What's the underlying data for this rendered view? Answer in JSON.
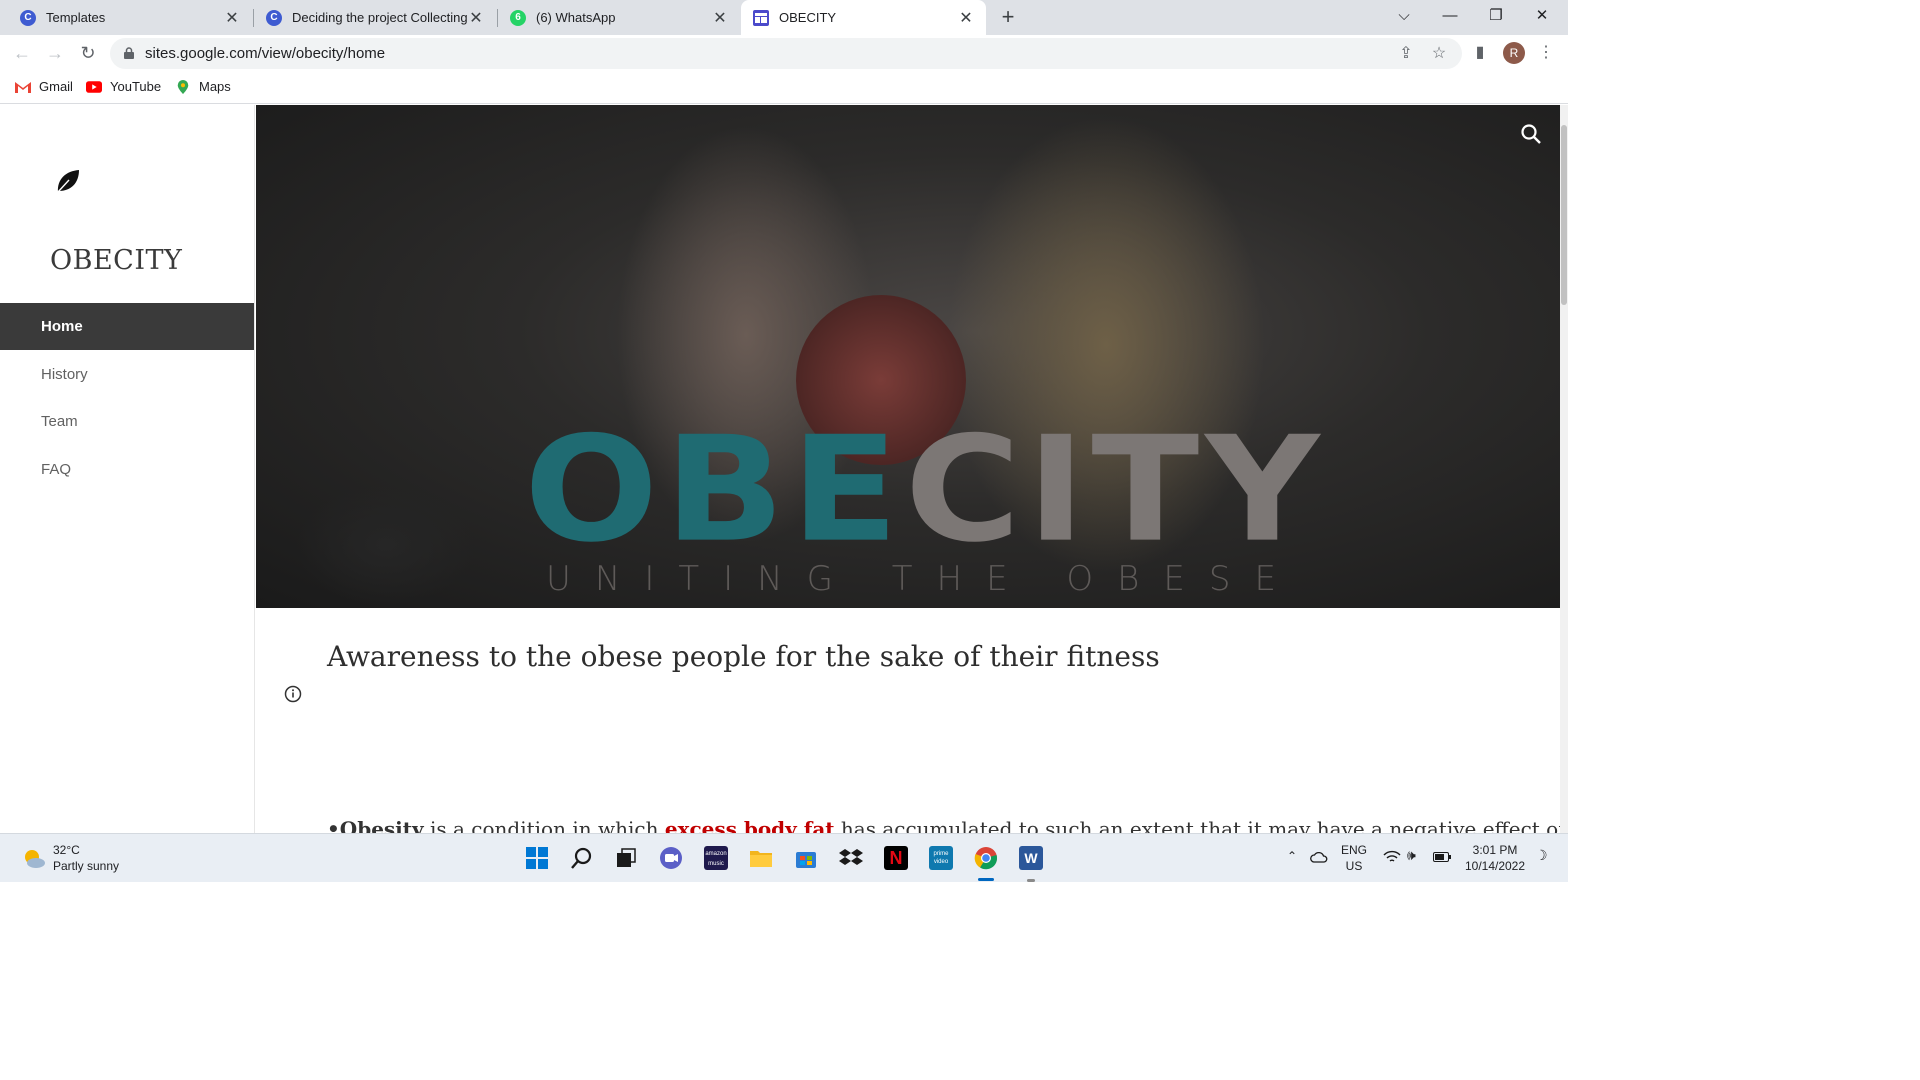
{
  "browser": {
    "tabs": [
      {
        "title": "Templates",
        "favicon": "canva-icon",
        "color": "#3e5bd1"
      },
      {
        "title": "Deciding the project Collecting p",
        "favicon": "canva-icon",
        "color": "#3e5bd1"
      },
      {
        "title": "(6) WhatsApp",
        "favicon": "whatsapp-icon",
        "color": "#25d366",
        "badge": "6"
      },
      {
        "title": "OBECITY",
        "favicon": "google-sites-icon",
        "color": "#4b4acb"
      }
    ],
    "url": "sites.google.com/view/obecity/home",
    "profile_initial": "R",
    "bookmarks": [
      {
        "label": "Gmail",
        "icon": "gmail-icon"
      },
      {
        "label": "YouTube",
        "icon": "youtube-icon"
      },
      {
        "label": "Maps",
        "icon": "maps-icon"
      }
    ]
  },
  "site": {
    "title": "OBECITY",
    "nav": [
      {
        "label": "Home",
        "active": true
      },
      {
        "label": "History",
        "active": false
      },
      {
        "label": "Team",
        "active": false
      },
      {
        "label": "FAQ",
        "active": false
      }
    ],
    "hero": {
      "logo_part1": "OBE",
      "logo_part2": "CITY",
      "tagline": "UNITING THE OBESE",
      "logo_colors": {
        "teal": "#1f6b72",
        "grey": "#7c7775"
      }
    },
    "heading": "Awareness to the obese people for the sake of their fitness",
    "paragraph": {
      "lead": "•Obesity",
      "text1": " is a condition in which ",
      "highlight": "excess body fat",
      "text2": " has accumulated to such an extent that it may have a negative effect on health"
    }
  },
  "taskbar": {
    "weather_temp": "32°C",
    "weather_condition": "Partly sunny",
    "lang_line1": "ENG",
    "lang_line2": "US",
    "time": "3:01 PM",
    "date": "10/14/2022"
  }
}
